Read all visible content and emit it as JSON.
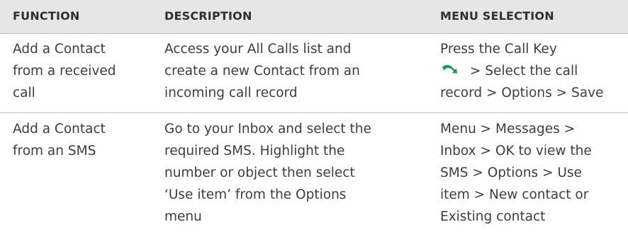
{
  "headers": {
    "function": "FUNCTION",
    "description": "DESCRIPTION",
    "menu_selection": "MENU SELECTION"
  },
  "rows": [
    {
      "function": [
        "Add a Contact",
        "from a received",
        "call"
      ],
      "description": [
        "Access your All Calls list and",
        "create a new Contact from an",
        "incoming call record"
      ],
      "menu_selection": {
        "line1": "Press the Call Key",
        "line2_after_icon": " > Select the call",
        "line3": "record > Options > Save",
        "icon": "call-key-icon",
        "icon_color": "#1a9a4a"
      }
    },
    {
      "function": [
        "Add a Contact",
        "from an SMS"
      ],
      "description": [
        "Go to your Inbox and select the",
        "required SMS. Highlight the",
        "number or object then select",
        "‘Use item’ from the Options",
        "menu"
      ],
      "menu_selection": [
        "Menu > Messages >",
        "Inbox > OK to view the",
        "SMS > Options > Use",
        "item > New contact or",
        "Existing contact"
      ]
    }
  ]
}
